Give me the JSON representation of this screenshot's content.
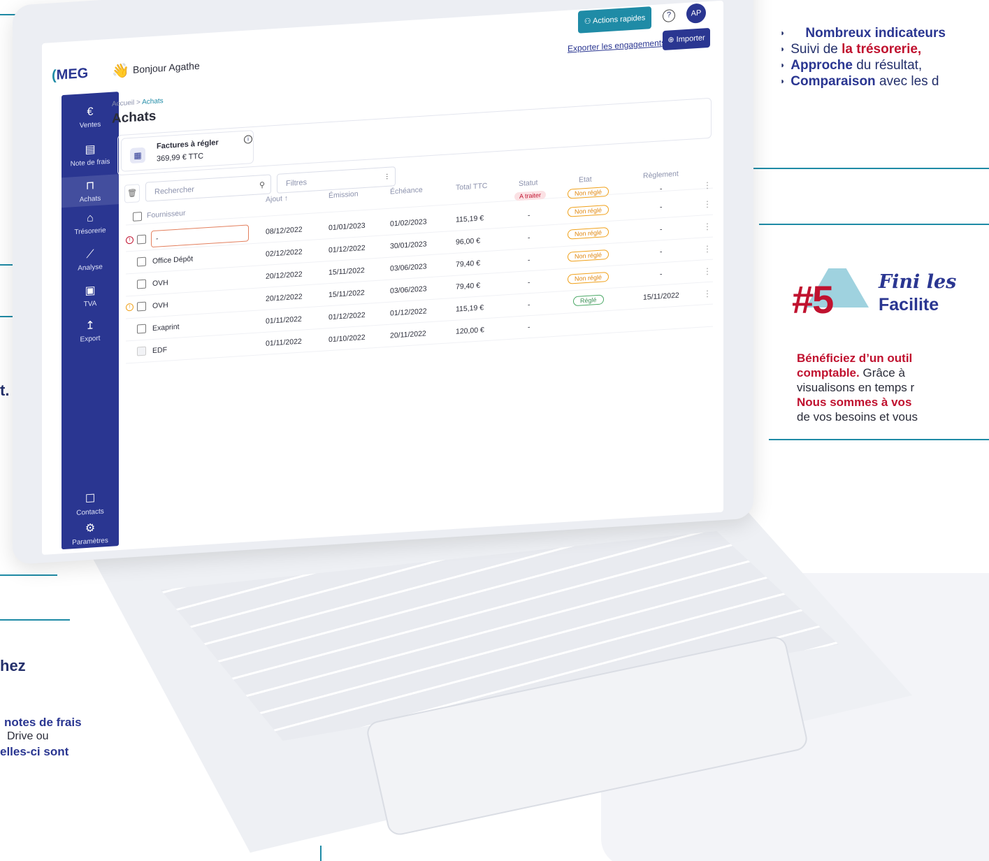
{
  "right_list": [
    {
      "bold": "Nombreux indicateurs",
      "rest": ""
    },
    {
      "pre": "Suivi de ",
      "bold": "la trésorerie,"
    },
    {
      "bold": "Approche",
      "rest": " du résultat,"
    },
    {
      "bold": "Comparaison",
      "rest": " avec les d"
    }
  ],
  "section5": {
    "number": "#5",
    "heading_italic": "Fini les",
    "heading_bold": "Facilite",
    "para": [
      {
        "red": "Bénéficiez d’un outil",
        "text": ""
      },
      {
        "red": "comptable.",
        "text": " Grâce à"
      },
      {
        "red": "",
        "text": "visualisons en temps r"
      },
      {
        "red": "Nous sommes à vos",
        "text": ""
      },
      {
        "red": "",
        "text": "de vos besoins et vous"
      }
    ]
  },
  "left_fragments": {
    "t1": "t.",
    "t2": "hez",
    "t3": "notes de frais",
    "t4": "Drive ou",
    "t5": "elles-ci sont"
  },
  "app": {
    "logo": "MEG",
    "greeting": "Bonjour Agathe",
    "quick_actions": "Actions rapides",
    "help": "?",
    "avatar": "AP",
    "export_link": "Exporter les engagements",
    "import_label": "Importer",
    "breadcrumb": {
      "root": "Accueil",
      "sep": " > ",
      "current": "Achats"
    },
    "page_title": "Achats",
    "summary_card": {
      "title": "Factures à régler",
      "value": "369,99 € TTC"
    },
    "search_placeholder": "Rechercher",
    "filter_placeholder": "Filtres",
    "nav": [
      {
        "icon": "€",
        "label": "Ventes"
      },
      {
        "icon": "▤",
        "label": "Note de frais"
      },
      {
        "icon": "⊓",
        "label": "Achats"
      },
      {
        "icon": "⌂",
        "label": "Trésorerie"
      },
      {
        "icon": "⟋",
        "label": "Analyse"
      },
      {
        "icon": "▣",
        "label": "TVA"
      },
      {
        "icon": "↥",
        "label": "Export"
      },
      {
        "icon": "☐",
        "label": "Contacts"
      },
      {
        "icon": "⚙",
        "label": "Paramètres"
      }
    ],
    "columns": {
      "fournisseur": "Fournisseur",
      "ajout": "Ajout ↑",
      "emission": "Émission",
      "echeance": "Échéance",
      "total": "Total TTC",
      "statut": "Statut",
      "etat": "Etat",
      "reglement": "Règlement"
    },
    "top_row": {
      "statut": "A traiter",
      "etat": "Non réglé",
      "reglement": "-"
    },
    "rows": [
      {
        "fournisseur": "-",
        "ajout": "08/12/2022",
        "emission": "01/01/2023",
        "echeance": "01/02/2023",
        "total": "115,19 €",
        "statut": "-",
        "etat": "Non réglé",
        "reglement": "-"
      },
      {
        "fournisseur": "Office Dépôt",
        "ajout": "02/12/2022",
        "emission": "01/12/2022",
        "echeance": "30/01/2023",
        "total": "96,00 €",
        "statut": "-",
        "etat": "Non réglé",
        "reglement": "-"
      },
      {
        "fournisseur": "OVH",
        "ajout": "20/12/2022",
        "emission": "15/11/2022",
        "echeance": "03/06/2023",
        "total": "79,40 €",
        "statut": "-",
        "etat": "Non réglé",
        "reglement": "-"
      },
      {
        "fournisseur": "OVH",
        "ajout": "20/12/2022",
        "emission": "15/11/2022",
        "echeance": "03/06/2023",
        "total": "79,40 €",
        "statut": "-",
        "etat": "Non réglé",
        "reglement": "-"
      },
      {
        "fournisseur": "Exaprint",
        "ajout": "01/11/2022",
        "emission": "01/12/2022",
        "echeance": "01/12/2022",
        "total": "115,19 €",
        "statut": "-",
        "etat": "Réglé",
        "reglement": "15/11/2022"
      },
      {
        "fournisseur": "EDF",
        "ajout": "01/11/2022",
        "emission": "01/10/2022",
        "echeance": "20/11/2022",
        "total": "120,00 €",
        "statut": "-",
        "etat": "",
        "reglement": ""
      }
    ]
  }
}
